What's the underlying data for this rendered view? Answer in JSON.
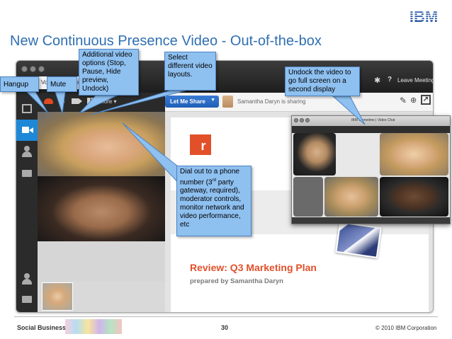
{
  "slide": {
    "title": "New Continuous Presence Video - Out-of-the-box",
    "logo_text": "IBM"
  },
  "app": {
    "voice_and_video_tab": "Voice and Video",
    "leave_meeting": "Leave Meeting",
    "let_me_share": "Let Me Share",
    "presenter_status": "Samantha Daryn is sharing",
    "more_menu": "More",
    "sidebar_icons": [
      "layout-icon",
      "video-icon",
      "person-icon",
      "folder-icon"
    ]
  },
  "shared_slide": {
    "logo_letter": "r",
    "heading": "Review: Q3 Marketing Plan",
    "subheading": "prepared by Samantha Daryn"
  },
  "undock_window": {
    "title": "IBM Sametime | Video Chat"
  },
  "callouts": {
    "hangup": "Hangup",
    "mute": "Mute",
    "additional": "Additional video options (Stop, Pause, Hide preview, Undock)",
    "select": "Select different video layouts.",
    "undock": "Undock the video to go full screen on a second display",
    "dialout_prefix": "Dial out to a phone number (3",
    "dialout_sup": "rd",
    "dialout_suffix": " party gateway, required), moderator controls, monitor network and video performance, etc"
  },
  "footer": {
    "left": "Social Business",
    "page": "30",
    "right": "© 2010 IBM Corporation"
  },
  "colors": {
    "title_blue": "#2f6fb2",
    "callout_fill": "#8ec0f0",
    "accent_orange": "#e2502a",
    "active_blue": "#1e88d8"
  }
}
